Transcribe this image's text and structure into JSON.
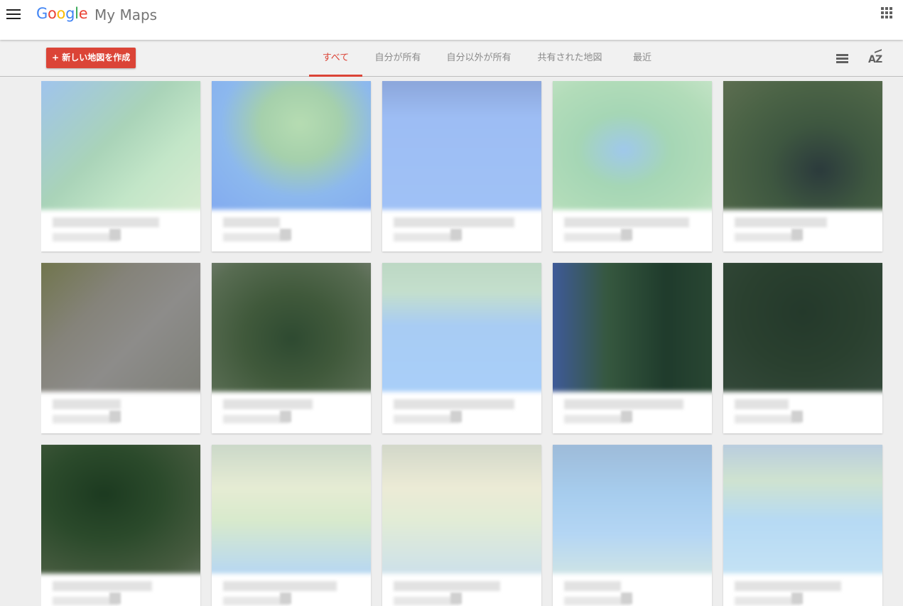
{
  "header": {
    "logo_text": "Google",
    "product_name": "My Maps"
  },
  "toolbar": {
    "create_label": "+ 新しい地図を作成",
    "tabs": [
      {
        "label": "すべて",
        "active": true
      },
      {
        "label": "自分が所有",
        "active": false
      },
      {
        "label": "自分以外が所有",
        "active": false
      },
      {
        "label": "共有された地図",
        "active": false
      },
      {
        "label": "最近",
        "active": false
      }
    ],
    "sort_label": "AZ"
  },
  "colors": {
    "accent": "#db4437",
    "tab_inactive": "#8a8a8a",
    "toolbar_bg": "#f1f1f1",
    "page_bg": "#eeeeee"
  },
  "icons": [
    "menu-icon",
    "apps-icon",
    "list-view-icon",
    "sort-az-icon"
  ]
}
